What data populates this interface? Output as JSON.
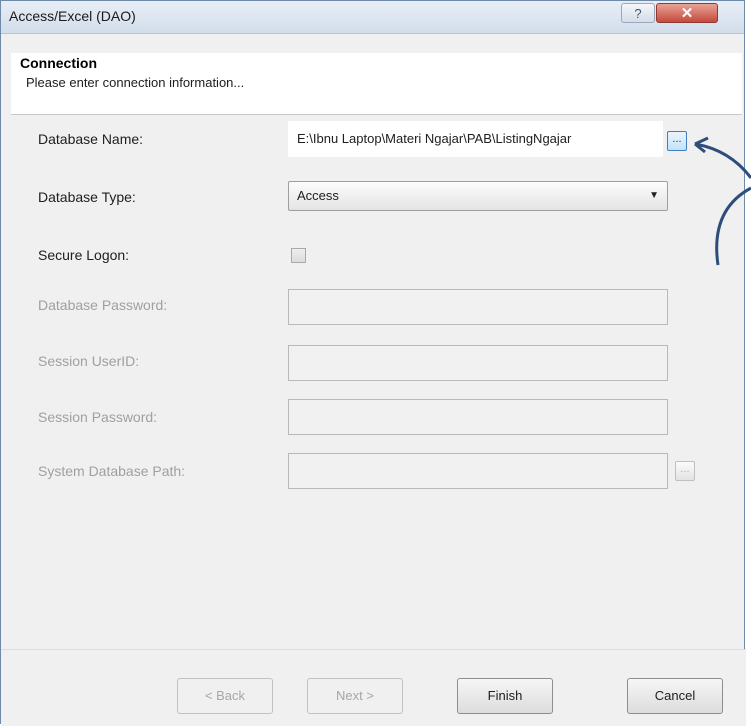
{
  "window": {
    "title": "Access/Excel (DAO)",
    "help_glyph": "?",
    "close_glyph": "✕"
  },
  "header": {
    "title": "Connection",
    "subtitle": "Please enter connection information..."
  },
  "form": {
    "database_name": {
      "label": "Database Name:",
      "value": "E:\\Ibnu Laptop\\Materi Ngajar\\PAB\\ListingNgajar"
    },
    "database_type": {
      "label": "Database Type:",
      "value": "Access"
    },
    "secure_logon": {
      "label": "Secure Logon:",
      "checked": false
    },
    "database_password": {
      "label": "Database Password:"
    },
    "session_userid": {
      "label": "Session UserID:"
    },
    "session_password": {
      "label": "Session Password:"
    },
    "system_database_path": {
      "label": "System Database Path:"
    },
    "browse_label": "..."
  },
  "buttons": {
    "back": "< Back",
    "next": "Next >",
    "finish": "Finish",
    "cancel": "Cancel"
  },
  "colors": {
    "annotation": "#2e4d7a",
    "focus": "#3d7fc4"
  }
}
